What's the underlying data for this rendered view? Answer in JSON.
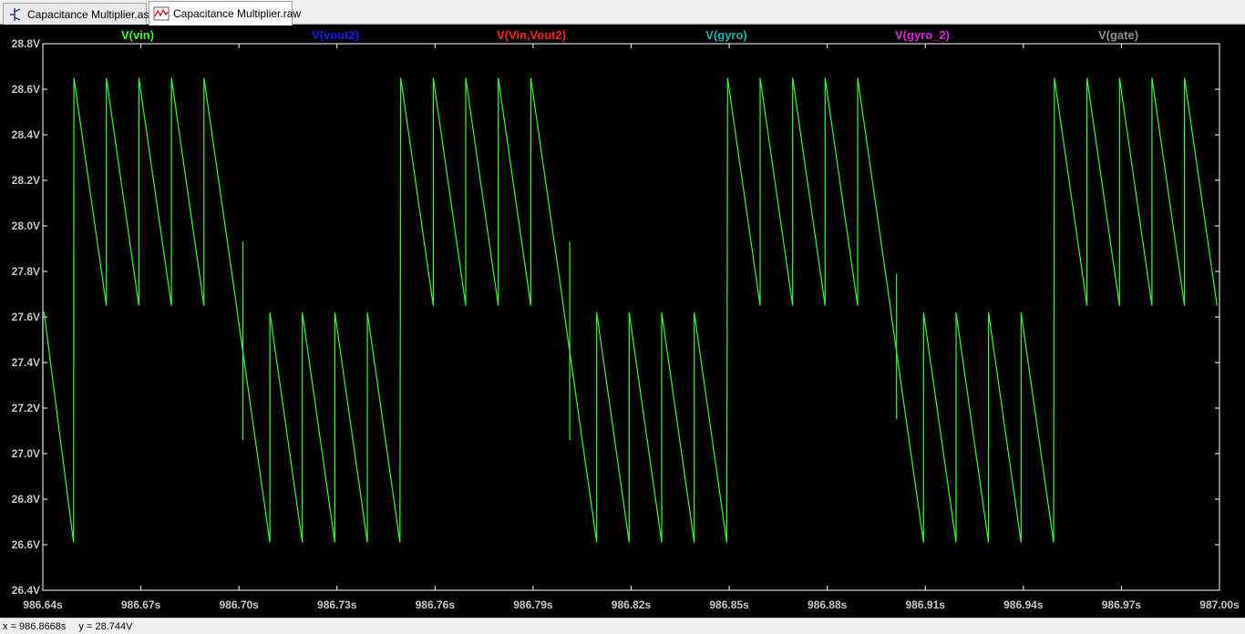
{
  "tabs": [
    {
      "label": "Capacitance Multiplier.asc",
      "icon": "schematic-icon",
      "active": false
    },
    {
      "label": "Capacitance Multiplier.raw",
      "icon": "waveform-icon",
      "active": true
    }
  ],
  "status": {
    "x_readout": "x = 986.8668s",
    "y_readout": "y = 28.744V"
  },
  "colors": {
    "background": "#000000",
    "axis": "#ffffff",
    "tick_label": "#c8c8c8",
    "trace_vin": "#33ff33"
  },
  "chart_data": {
    "type": "line",
    "x_ticks": [
      "986.64s",
      "986.67s",
      "986.70s",
      "986.73s",
      "986.76s",
      "986.79s",
      "986.82s",
      "986.85s",
      "986.88s",
      "986.91s",
      "986.94s",
      "986.97s",
      "987.00s"
    ],
    "y_ticks": [
      "28.8V",
      "28.6V",
      "28.4V",
      "28.2V",
      "28.0V",
      "27.8V",
      "27.6V",
      "27.4V",
      "27.2V",
      "27.0V",
      "26.8V",
      "26.6V",
      "26.4V"
    ],
    "xlim": [
      986.64,
      987.0
    ],
    "ylim": [
      26.4,
      28.8
    ],
    "legend": [
      {
        "name": "V(vin)",
        "color": "#33ff33"
      },
      {
        "name": "V(vout2)",
        "color": "#1a1aff"
      },
      {
        "name": "V(Vin,Vout2)",
        "color": "#ff2020"
      },
      {
        "name": "V(gyro)",
        "color": "#20b0b0"
      },
      {
        "name": "V(gyro_2)",
        "color": "#e020e0"
      },
      {
        "name": "V(gate)",
        "color": "#909090"
      }
    ],
    "grid": false,
    "series": [
      {
        "name": "V(vin)",
        "color": "#33ff33",
        "segment_peak": 28.65,
        "segment_trough": 27.65,
        "segment_peak_low": 27.62,
        "segment_trough_low": 26.61,
        "period_s": 0.01,
        "high_segments": [
          {
            "x": [
              986.6495,
              986.6595,
              986.6695,
              986.6795,
              986.6895
            ]
          },
          {
            "x": [
              986.7495,
              986.7595,
              986.7695,
              986.7795,
              986.7895
            ]
          },
          {
            "x": [
              986.8495,
              986.8595,
              986.8695,
              986.8795,
              986.8895
            ]
          },
          {
            "x": [
              986.9495,
              986.9595,
              986.9695,
              986.9795,
              986.9895
            ]
          }
        ],
        "low_segments": [
          {
            "x": [
              986.6,
              986.6995,
              986.7095,
              986.7195,
              986.7295
            ]
          },
          {
            "x": [
              986.7995,
              986.8095,
              986.8195,
              986.8295
            ]
          },
          {
            "x": [
              986.8995,
              986.9095,
              986.9195,
              986.9295
            ]
          }
        ]
      }
    ]
  }
}
